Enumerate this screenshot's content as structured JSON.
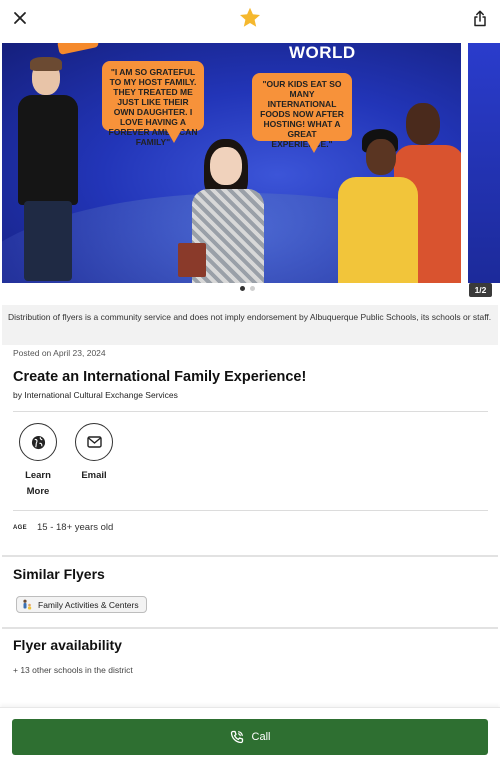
{
  "toolbar": {
    "close_icon": "close-icon",
    "favorite_icon": "star-icon",
    "share_icon": "share-icon",
    "star_color": "#F5B82E"
  },
  "carousel": {
    "counter": "1/2",
    "slide": {
      "heading_fragment": "WORLD",
      "quote_1": "\"I AM SO GRATEFUL TO MY HOST FAMILY. THEY TREATED ME JUST LIKE THEIR OWN DAUGHTER. I LOVE HAVING A FOREVER AMERICAN FAMILY\"",
      "quote_2": "\"OUR KIDS EAT SO MANY INTERNATIONAL FOODS NOW AFTER HOSTING! WHAT A GREAT EXPERIENCE.\""
    }
  },
  "disclaimer": "Distribution of flyers is a community service and does not imply endorsement by Albuquerque Public Schools, its schools or staff.",
  "flyer": {
    "posted": "Posted on April 23, 2024",
    "title": "Create an International Family Experience!",
    "byline": "by International Cultural Exchange Services"
  },
  "actions": {
    "learn_more": "Learn More",
    "email": "Email"
  },
  "age": {
    "tag": "AGE",
    "value": "15 - 18+ years old"
  },
  "similar": {
    "title": "Similar Flyers",
    "chip": "Family Activities & Centers"
  },
  "availability": {
    "title": "Flyer availability",
    "text": "+ 13 other schools in the district"
  },
  "call": {
    "label": "Call",
    "color": "#2E6F31"
  }
}
